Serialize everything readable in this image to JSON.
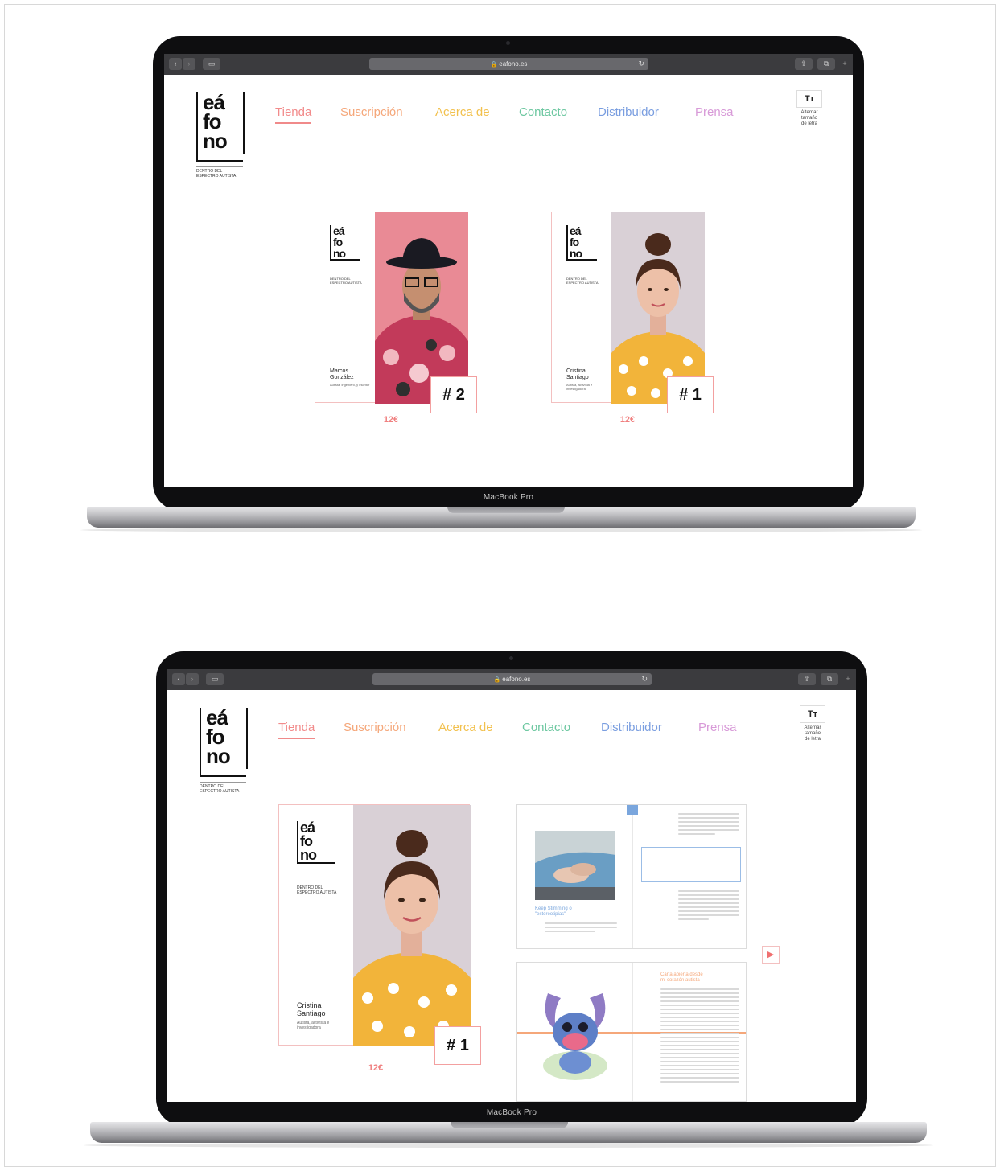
{
  "browser": {
    "url": "eafono.es",
    "back_icon": "chevron-left-icon",
    "forward_icon": "chevron-right-icon",
    "sidebar_icon": "sidebar-icon",
    "share_icon": "share-icon",
    "tabs_icon": "tabs-icon",
    "reload_icon": "reload-icon"
  },
  "device_label": "MacBook Pro",
  "logo": {
    "line1": "eá",
    "line2": "fo",
    "line3": "no",
    "subtitle_line1": "DENTRO DEL",
    "subtitle_line2": "ESPECTRO AUTISTA"
  },
  "nav": [
    {
      "label": "Tienda",
      "color": "#f28b8b",
      "active": true
    },
    {
      "label": "Suscripción",
      "color": "#f5a77a",
      "active": false
    },
    {
      "label": "Acerca de",
      "color": "#f2c14e",
      "active": false
    },
    {
      "label": "Contacto",
      "color": "#6cc7a0",
      "active": false
    },
    {
      "label": "Distribuidor",
      "color": "#7a9ee0",
      "active": false
    },
    {
      "label": "Prensa",
      "color": "#d89ad8",
      "active": false
    }
  ],
  "text_size": {
    "button": "Tт",
    "label_line1": "Alternar",
    "label_line2": "tamaño",
    "label_line3": "de letra"
  },
  "screen1": {
    "products": [
      {
        "issue": "# 2",
        "price": "12€",
        "name_line1": "Marcos",
        "name_line2": "González",
        "role": "Autista, ingeniero, y escritor",
        "photo_bg": "#e98a95"
      },
      {
        "issue": "# 1",
        "price": "12€",
        "name_line1": "Cristina",
        "name_line2": "Santiago",
        "role": "Autista, activista e investigadora",
        "photo_bg": "#d9d0d6"
      }
    ]
  },
  "screen2": {
    "product": {
      "issue": "# 1",
      "price": "12€",
      "name_line1": "Cristina",
      "name_line2": "Santiago",
      "role": "Autista, activista e investigadora"
    },
    "spread1": {
      "heading_line1": "Keep Stimming o",
      "heading_line2": "\"estereotipias\""
    },
    "spread2": {
      "heading_line1": "Carta abierta desde",
      "heading_line2": "mi corazón autista"
    },
    "next_icon": "play-right-icon"
  },
  "colors": {
    "accent": "#f08a8a",
    "yellow_shirt": "#f2b43a",
    "floral": "#c23a5a",
    "heading_blue": "#7aa6dd",
    "heading_orange": "#f5a77a"
  }
}
